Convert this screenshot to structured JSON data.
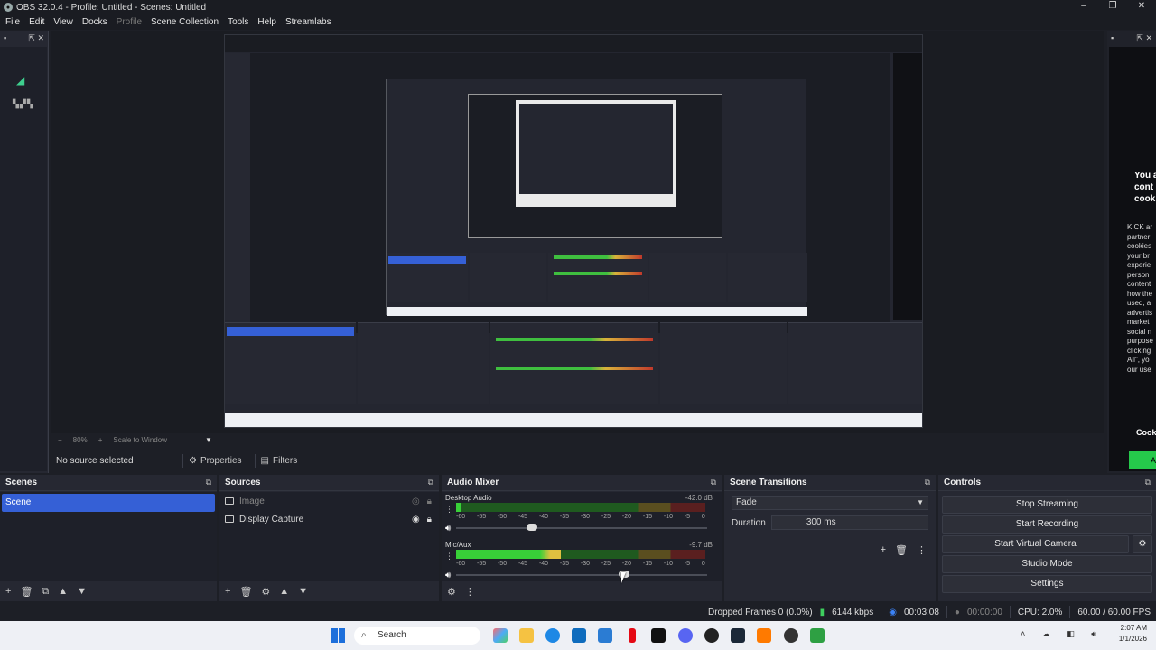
{
  "window": {
    "title": "OBS 32.0.4 - Profile: Untitled - Scenes: Untitled",
    "controls": [
      "–",
      "❐",
      "✕"
    ]
  },
  "menu": {
    "items": [
      "File",
      "Edit",
      "View",
      "Docks",
      "Profile",
      "Scene Collection",
      "Tools",
      "Help",
      "Streamlabs"
    ]
  },
  "left_dock": {
    "controls": "⇱ ✕"
  },
  "right_dock": {
    "controls": "⇱ ✕",
    "cookie_title": "You a\ncont\ncook",
    "cookie_text": "KICK ar\npartner\ncookies\nyour br\nexperie\nperson\ncontent\nhow the\nused, a\nadvertis\nmarket\nsocial n\npurpose\nclicking\nAll\", yo\nour use",
    "cookie_link": "Cook",
    "accept_label": "Ac"
  },
  "preview_bar": {
    "zoom": "80%",
    "scale_label": "Scale to Window"
  },
  "selection_bar": {
    "no_source": "No source selected",
    "properties": "Properties",
    "filters": "Filters"
  },
  "scenes": {
    "title": "Scenes",
    "items": [
      "Scene"
    ],
    "footer": [
      "+",
      "🗑",
      "⧉",
      "▲",
      "▼"
    ]
  },
  "sources": {
    "title": "Sources",
    "items": [
      {
        "name": "Image",
        "dimmed": true
      },
      {
        "name": "Display Capture",
        "dimmed": false
      }
    ],
    "footer": [
      "+",
      "🗑",
      "⚙",
      "▲",
      "▼"
    ]
  },
  "audio_mixer": {
    "title": "Audio Mixer",
    "channels": [
      {
        "name": "Desktop Audio",
        "db": "-42.0 dB",
        "level": 0.02,
        "volume": 0.3
      },
      {
        "name": "Mic/Aux",
        "db": "-9.7 dB",
        "level": 0.42,
        "volume": 0.67
      }
    ],
    "scale": [
      "-60",
      "-55",
      "-50",
      "-45",
      "-40",
      "-35",
      "-30",
      "-25",
      "-20",
      "-15",
      "-10",
      "-5",
      "0"
    ]
  },
  "scene_transitions": {
    "title": "Scene Transitions",
    "transition": "Fade",
    "duration_label": "Duration",
    "duration_value": "300 ms"
  },
  "controls": {
    "title": "Controls",
    "buttons": [
      "Stop Streaming",
      "Start Recording",
      "Start Virtual Camera",
      "Studio Mode",
      "Settings"
    ]
  },
  "status": {
    "dropped_frames": "Dropped Frames 0 (0.0%)",
    "bitrate": "6144 kbps",
    "stream_time": "00:03:08",
    "rec_time": "00:00:00",
    "cpu": "CPU: 2.0%",
    "fps": "60.00 / 60.00 FPS"
  },
  "taskbar": {
    "search": "Search",
    "time": "2:07 AM",
    "date": "1/1/2026"
  }
}
